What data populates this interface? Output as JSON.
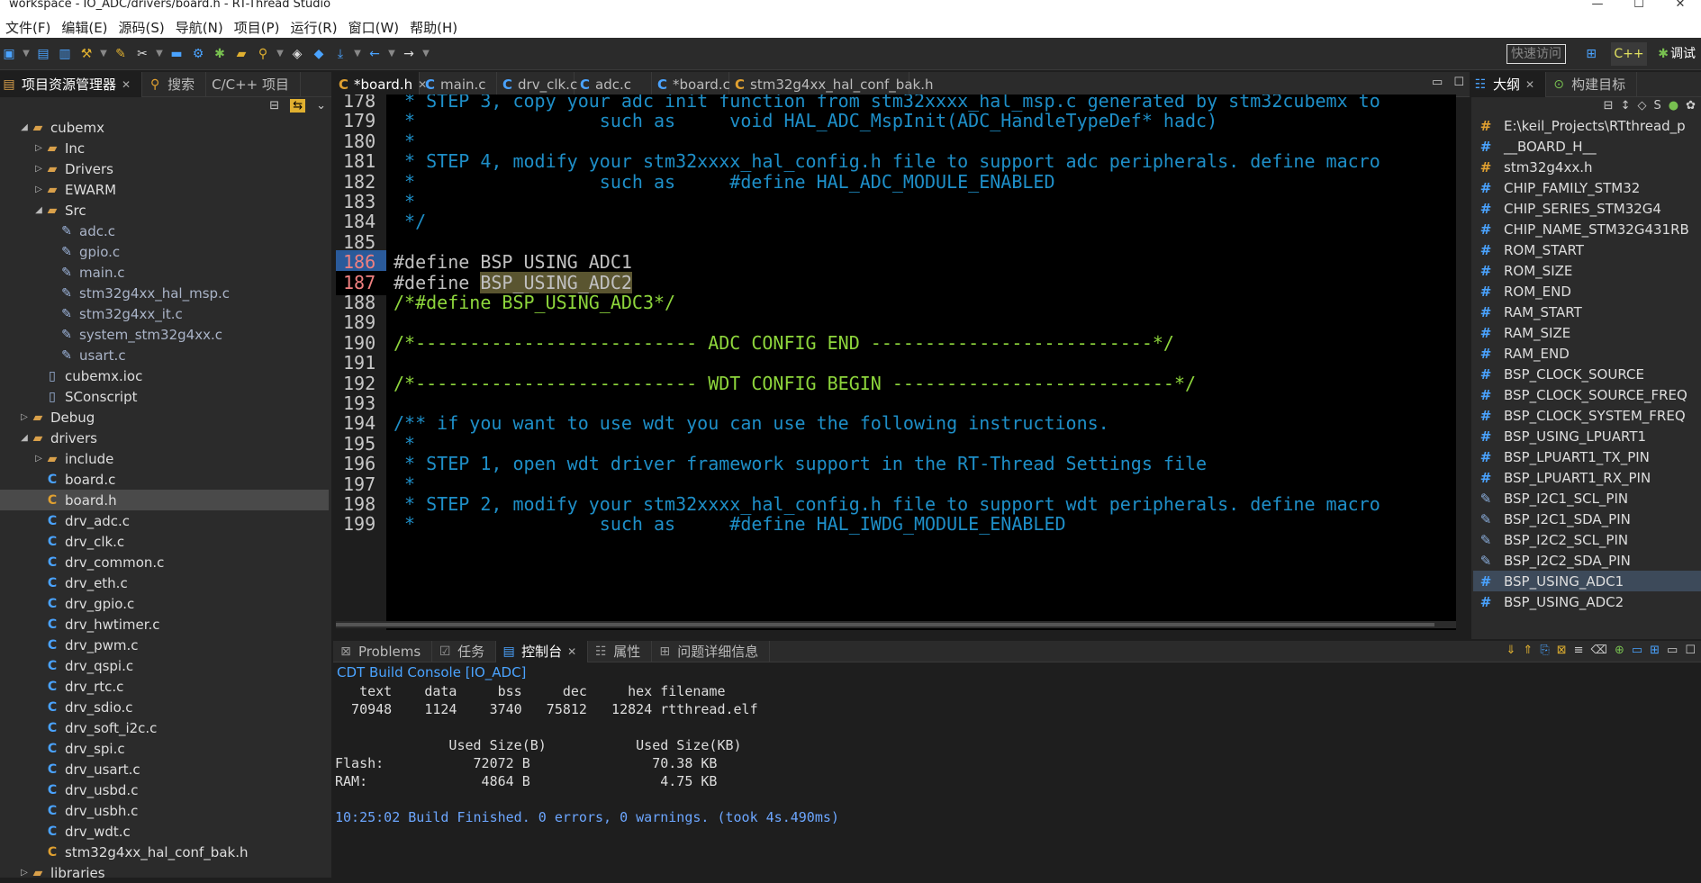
{
  "window": {
    "title": "workspace - IO_ADC/drivers/board.h - RT-Thread Studio",
    "min": "—",
    "max": "☐",
    "close": "✕"
  },
  "menu": [
    "文件(F)",
    "编辑(E)",
    "源码(S)",
    "导航(N)",
    "项目(P)",
    "运行(R)",
    "窗口(W)",
    "帮助(H)"
  ],
  "toolbar": {
    "quick_access": "快速访问",
    "debug_label": "调试"
  },
  "left_panel": {
    "tabs": [
      {
        "label": "项目资源管理器"
      },
      {
        "label": "搜索"
      },
      {
        "label": "C/C++ 项目"
      }
    ],
    "tree": [
      {
        "label": "cubemx",
        "type": "folder",
        "depth": 1,
        "expanded": true
      },
      {
        "label": "Inc",
        "type": "folder",
        "depth": 2,
        "expanded": false
      },
      {
        "label": "Drivers",
        "type": "folder",
        "depth": 2,
        "expanded": false
      },
      {
        "label": "EWARM",
        "type": "folder",
        "depth": 2,
        "expanded": false
      },
      {
        "label": "Src",
        "type": "folder",
        "depth": 2,
        "expanded": true
      },
      {
        "label": "adc.c",
        "type": "src",
        "depth": 3
      },
      {
        "label": "gpio.c",
        "type": "src",
        "depth": 3
      },
      {
        "label": "main.c",
        "type": "src",
        "depth": 3
      },
      {
        "label": "stm32g4xx_hal_msp.c",
        "type": "src",
        "depth": 3
      },
      {
        "label": "stm32g4xx_it.c",
        "type": "src",
        "depth": 3
      },
      {
        "label": "system_stm32g4xx.c",
        "type": "src",
        "depth": 3
      },
      {
        "label": "usart.c",
        "type": "src",
        "depth": 3
      },
      {
        "label": "cubemx.ioc",
        "type": "file",
        "depth": 2
      },
      {
        "label": "SConscript",
        "type": "file",
        "depth": 2
      },
      {
        "label": "Debug",
        "type": "folder",
        "depth": 1,
        "expanded": false
      },
      {
        "label": "drivers",
        "type": "folder",
        "depth": 1,
        "expanded": true
      },
      {
        "label": "include",
        "type": "folder",
        "depth": 2,
        "expanded": false
      },
      {
        "label": "board.c",
        "type": "c",
        "depth": 2
      },
      {
        "label": "board.h",
        "type": "h",
        "depth": 2,
        "selected": true
      },
      {
        "label": "drv_adc.c",
        "type": "c",
        "depth": 2
      },
      {
        "label": "drv_clk.c",
        "type": "c",
        "depth": 2
      },
      {
        "label": "drv_common.c",
        "type": "c",
        "depth": 2
      },
      {
        "label": "drv_eth.c",
        "type": "c",
        "depth": 2
      },
      {
        "label": "drv_gpio.c",
        "type": "c",
        "depth": 2
      },
      {
        "label": "drv_hwtimer.c",
        "type": "c",
        "depth": 2
      },
      {
        "label": "drv_pwm.c",
        "type": "c",
        "depth": 2
      },
      {
        "label": "drv_qspi.c",
        "type": "c",
        "depth": 2
      },
      {
        "label": "drv_rtc.c",
        "type": "c",
        "depth": 2
      },
      {
        "label": "drv_sdio.c",
        "type": "c",
        "depth": 2
      },
      {
        "label": "drv_soft_i2c.c",
        "type": "c",
        "depth": 2
      },
      {
        "label": "drv_spi.c",
        "type": "c",
        "depth": 2
      },
      {
        "label": "drv_usart.c",
        "type": "c",
        "depth": 2
      },
      {
        "label": "drv_usbd.c",
        "type": "c",
        "depth": 2
      },
      {
        "label": "drv_usbh.c",
        "type": "c",
        "depth": 2
      },
      {
        "label": "drv_wdt.c",
        "type": "c",
        "depth": 2
      },
      {
        "label": "stm32g4xx_hal_conf_bak.h",
        "type": "h",
        "depth": 2
      },
      {
        "label": "libraries",
        "type": "folder",
        "depth": 1,
        "expanded": false
      }
    ]
  },
  "editor": {
    "tabs": [
      {
        "label": "*board.h",
        "icon": "h",
        "active": true
      },
      {
        "label": "main.c",
        "icon": "c"
      },
      {
        "label": "drv_clk.c",
        "icon": "c"
      },
      {
        "label": "adc.c",
        "icon": "c"
      },
      {
        "label": "*board.c",
        "icon": "c"
      },
      {
        "label": "stm32g4xx_hal_conf_bak.h",
        "icon": "h"
      }
    ],
    "lines": [
      {
        "n": "178",
        "cls": "cm",
        "text": " * STEP 3, copy your adc init function from stm32xxxx_hal_msp.c generated by stm32cubemx to"
      },
      {
        "n": "179",
        "cls": "cm",
        "text": " *                 such as     void HAL_ADC_MspInit(ADC_HandleTypeDef* hadc)"
      },
      {
        "n": "180",
        "cls": "cm",
        "text": " *"
      },
      {
        "n": "181",
        "cls": "cm",
        "text": " * STEP 4, modify your stm32xxxx_hal_config.h file to support adc peripherals. define macro"
      },
      {
        "n": "182",
        "cls": "cm",
        "text": " *                 such as     #define HAL_ADC_MODULE_ENABLED"
      },
      {
        "n": "183",
        "cls": "cm",
        "text": " *"
      },
      {
        "n": "184",
        "cls": "cm",
        "text": " */"
      },
      {
        "n": "185",
        "cls": "df",
        "text": ""
      },
      {
        "n": "186",
        "cls": "df",
        "text": "#define BSP_USING_ADC1"
      },
      {
        "n": "187",
        "cls": "df",
        "text": "#define BSP_USING_ADC2"
      },
      {
        "n": "188",
        "cls": "gr",
        "text": "/*#define BSP_USING_ADC3*/"
      },
      {
        "n": "189",
        "cls": "df",
        "text": ""
      },
      {
        "n": "190",
        "cls": "gr",
        "text": "/*-------------------------- ADC CONFIG END --------------------------*/"
      },
      {
        "n": "191",
        "cls": "df",
        "text": ""
      },
      {
        "n": "192",
        "cls": "gr",
        "text": "/*-------------------------- WDT CONFIG BEGIN --------------------------*/"
      },
      {
        "n": "193",
        "cls": "df",
        "text": ""
      },
      {
        "n": "194",
        "cls": "cm",
        "text": "/** if you want to use wdt you can use the following instructions."
      },
      {
        "n": "195",
        "cls": "cm",
        "text": " *"
      },
      {
        "n": "196",
        "cls": "cm",
        "text": " * STEP 1, open wdt driver framework support in the RT-Thread Settings file"
      },
      {
        "n": "197",
        "cls": "cm",
        "text": " *"
      },
      {
        "n": "198",
        "cls": "cm",
        "text": " * STEP 2, modify your stm32xxxx_hal_config.h file to support wdt peripherals. define macro"
      },
      {
        "n": "199",
        "cls": "cm",
        "text": " *                 such as     #define HAL_IWDG_MODULE_ENABLED"
      }
    ]
  },
  "bottom": {
    "tabs": [
      {
        "label": "Problems"
      },
      {
        "label": "任务"
      },
      {
        "label": "控制台",
        "active": true
      },
      {
        "label": "属性"
      },
      {
        "label": "问题详细信息"
      }
    ],
    "console_title": "CDT Build Console [IO_ADC]",
    "console_lines": [
      "   text    data     bss     dec     hex filename",
      "  70948    1124    3740   75812   12824 rtthread.elf",
      "",
      "              Used Size(B)           Used Size(KB)",
      "Flash:           72072 B               70.38 KB",
      "RAM:              4864 B                4.75 KB"
    ],
    "build_result": "10:25:02 Build Finished. 0 errors, 0 warnings. (took 4s.490ms)"
  },
  "right_panel": {
    "tabs": [
      {
        "label": "大纲",
        "active": true
      },
      {
        "label": "构建目标"
      }
    ],
    "items": [
      {
        "label": "E:\\keil_Projects\\RTthread_p",
        "icon": "o"
      },
      {
        "label": "__BOARD_H__",
        "icon": "b"
      },
      {
        "label": "stm32g4xx.h",
        "icon": "o"
      },
      {
        "label": "CHIP_FAMILY_STM32",
        "icon": "b"
      },
      {
        "label": "CHIP_SERIES_STM32G4",
        "icon": "b"
      },
      {
        "label": "CHIP_NAME_STM32G431RB",
        "icon": "b"
      },
      {
        "label": "ROM_START",
        "icon": "b"
      },
      {
        "label": "ROM_SIZE",
        "icon": "b"
      },
      {
        "label": "ROM_END",
        "icon": "b"
      },
      {
        "label": "RAM_START",
        "icon": "b"
      },
      {
        "label": "RAM_SIZE",
        "icon": "b"
      },
      {
        "label": "RAM_END",
        "icon": "b"
      },
      {
        "label": "BSP_CLOCK_SOURCE",
        "icon": "b"
      },
      {
        "label": "BSP_CLOCK_SOURCE_FREQ",
        "icon": "b"
      },
      {
        "label": "BSP_CLOCK_SYSTEM_FREQ",
        "icon": "b"
      },
      {
        "label": "BSP_USING_LPUART1",
        "icon": "b"
      },
      {
        "label": "BSP_LPUART1_TX_PIN",
        "icon": "b"
      },
      {
        "label": "BSP_LPUART1_RX_PIN",
        "icon": "b"
      },
      {
        "label": "BSP_I2C1_SCL_PIN",
        "icon": "x"
      },
      {
        "label": "BSP_I2C1_SDA_PIN",
        "icon": "x"
      },
      {
        "label": "BSP_I2C2_SCL_PIN",
        "icon": "x"
      },
      {
        "label": "BSP_I2C2_SDA_PIN",
        "icon": "x"
      },
      {
        "label": "BSP_USING_ADC1",
        "icon": "b",
        "selected": true
      },
      {
        "label": "BSP_USING_ADC2",
        "icon": "b"
      }
    ]
  }
}
